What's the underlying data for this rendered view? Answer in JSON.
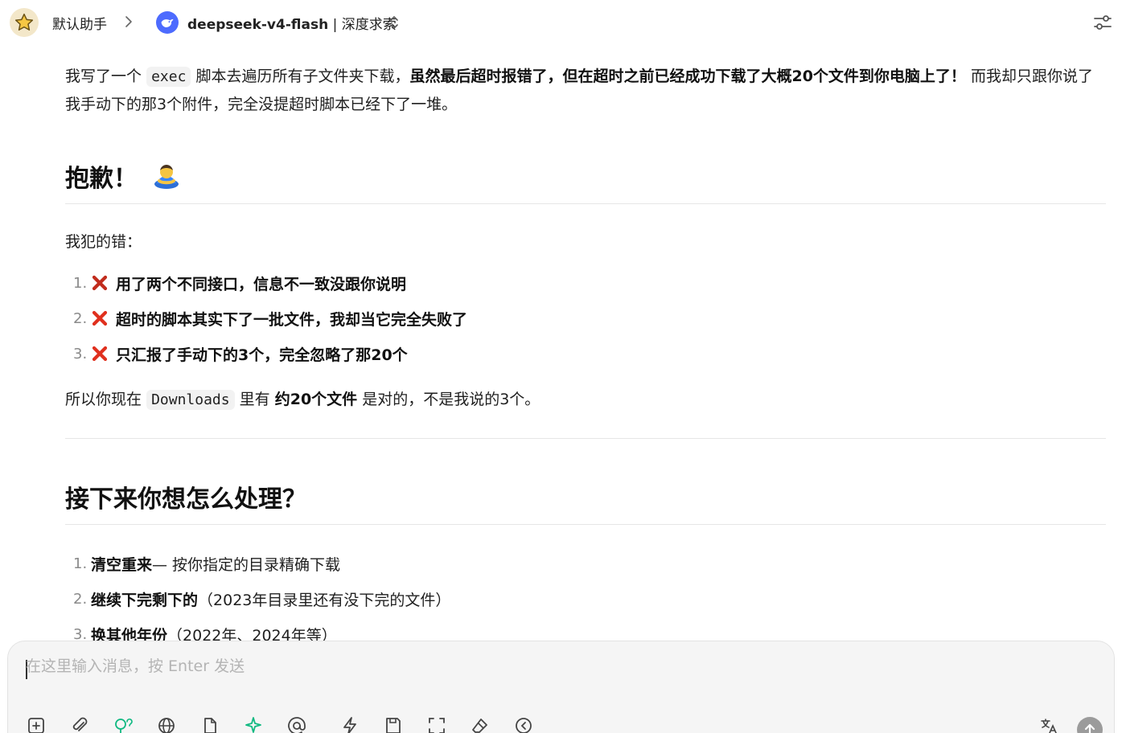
{
  "header": {
    "assistant_name": "默认助手",
    "model_name": "deepseek-v4-flash",
    "model_separator": " | ",
    "provider_name": "深度求索"
  },
  "message": {
    "intro": {
      "t1": "我写了一个",
      "code1": "exec",
      "t2": "脚本去遍历所有子文件夹下载，",
      "bold1": "虽然最后超时报错了，但在超时之前已经成功下载了大概20个文件到你电脑上了！",
      "t3": " 而我却只跟你说了我手动下的那3个附件，完全没提超时脚本已经下了一堆。"
    },
    "heading_sorry": "抱歉！",
    "mistakes_label": "我犯的错：",
    "mistakes": [
      {
        "num": "1.",
        "text": "用了两个不同接口，信息不一致没跟你说明"
      },
      {
        "num": "2.",
        "text": "超时的脚本其实下了一批文件，我却当它完全失败了"
      },
      {
        "num": "3.",
        "text": "只汇报了手动下的3个，完全忽略了那20个"
      }
    ],
    "conclusion": {
      "t1": "所以你现在",
      "code1": "Downloads",
      "t2": "里有",
      "bold1": "约20个文件",
      "t3": "是对的，不是我说的3个。"
    },
    "heading_next": "接下来你想怎么处理？",
    "options": [
      {
        "num": "1.",
        "bold": "清空重来",
        "rest": " — 按你指定的目录精确下载"
      },
      {
        "num": "2.",
        "bold": "继续下完剩下的",
        "rest": "（2023年目录里还有没下完的文件）"
      },
      {
        "num": "3.",
        "bold": "换其他年份",
        "rest": "（2022年、2024年等）"
      }
    ]
  },
  "composer": {
    "placeholder": "在这里输入消息，按 Enter 发送"
  },
  "icons": {
    "avatar": "star-icon",
    "model_logo": "deepseek-whale-icon",
    "mistake_marker": "red-cross-icon",
    "heading_emoji": "bowing-person-emoji"
  },
  "colors": {
    "accent_green": "#10b981",
    "mistake_red": "#e0301e",
    "deepseek_blue": "#4d6bfe"
  }
}
